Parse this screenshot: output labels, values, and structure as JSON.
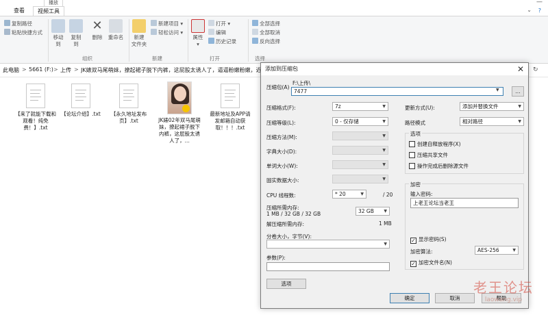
{
  "ribbon": {
    "tabs": [
      "查看",
      "视频工具"
    ],
    "active_tab_top": "播放",
    "clipboard": {
      "copy_path": "复制路径",
      "paste_shortcut": "粘贴快捷方式"
    },
    "organize": {
      "move_to": "移动到",
      "copy_to": "复制到",
      "delete": "删除",
      "rename": "重命名",
      "label": "组织"
    },
    "new": {
      "new_folder": "新建\n文件夹",
      "new_item": "新建项目",
      "easy_access": "轻松访问",
      "label": "新建"
    },
    "open": {
      "properties": "属性",
      "open": "打开",
      "edit": "编辑",
      "history": "历史记录",
      "label": "打开"
    },
    "select": {
      "select_all": "全部选择",
      "select_none": "全部取消",
      "invert": "反向选择",
      "label": "选择"
    }
  },
  "address": {
    "crumbs": [
      "此电脑",
      "5661 (F:)",
      "上传",
      "JK婊双马尾萌妹，撩起裙子脱下内裤，这屁股太诱人了，逼逼粉嫩粉嫩，近距离"
    ],
    "separator": ">"
  },
  "files": [
    {
      "name": "【来了就能下载和观看！纯免费！】.txt"
    },
    {
      "name": "【论坛介绍】.txt"
    },
    {
      "name": "【永久地址发布页】.txt"
    },
    {
      "name": "JK婊02年双马尾萌妹，撩起裙子脱下内裤，这屁股太诱人了，..."
    },
    {
      "name": "最新地址及APP请发邮箱自动获取！！！.txt"
    }
  ],
  "dialog": {
    "title": "添加到压缩包",
    "close": "✕",
    "archive_label": "压缩包(A)",
    "archive_path": "F:\\上传\\",
    "archive_name": "7477",
    "browse": "...",
    "format_label": "压缩格式(F):",
    "format_value": "7z",
    "level_label": "压缩等级(L):",
    "level_value": "0 - 仅存储",
    "method_label": "压缩方法(M):",
    "dict_label": "字典大小(D):",
    "word_label": "单词大小(W):",
    "solid_label": "固实数据大小:",
    "cpu_label": "CPU 线程数:",
    "cpu_value": "* 20",
    "cpu_total": "/ 20",
    "mem_comp_label": "压缩所需内存:",
    "mem_comp_detail": "1 MB / 32 GB / 32 GB",
    "mem_comp_value": "32 GB",
    "mem_decomp_label": "解压缩所需内存:",
    "mem_decomp_value": "1 MB",
    "split_label": "分卷大小，字节(V):",
    "params_label": "参数(P):",
    "options_btn": "选项",
    "update_label": "更新方式(U):",
    "update_value": "添加并替换文件",
    "path_mode_label": "路径模式",
    "path_mode_value": "相对路径",
    "options_group": "选项",
    "opt_sfx": "创建自释放程序(X)",
    "opt_shared": "压缩共享文件",
    "opt_delete": "操作完成后删除源文件",
    "encrypt_group": "加密",
    "password_label": "输入密码:",
    "password_value": "上老王论坛当老王",
    "show_password": "显示密码(S)",
    "enc_method_label": "加密算法:",
    "enc_method_value": "AES-256",
    "encrypt_names": "加密文件名(N)",
    "ok": "确定",
    "cancel": "取消",
    "help": "帮助"
  },
  "watermark": {
    "line1": "老王论坛",
    "line2": "laowang.vip"
  }
}
